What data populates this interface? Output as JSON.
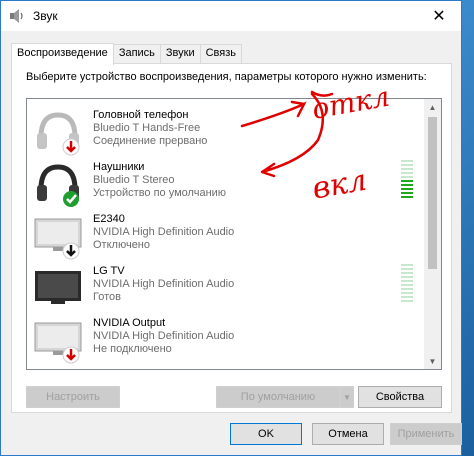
{
  "window": {
    "title": "Звук",
    "close_glyph": "✕"
  },
  "tabs": [
    {
      "label": "Воспроизведение",
      "active": true
    },
    {
      "label": "Запись",
      "active": false
    },
    {
      "label": "Звуки",
      "active": false
    },
    {
      "label": "Связь",
      "active": false
    }
  ],
  "instruction": "Выберите устройство воспроизведения, параметры которого нужно изменить:",
  "devices": [
    {
      "name": "Головной телефон",
      "model": "Bluedio T Hands-Free",
      "status": "Соединение прервано",
      "icon": "headphones-icon",
      "badge": "red-down-arrow",
      "meter": false
    },
    {
      "name": "Наушники",
      "model": "Bluedio T Stereo",
      "status": "Устройство по умолчанию",
      "icon": "headphones-icon",
      "badge": "green-check",
      "meter": true,
      "meter_level": 0.45
    },
    {
      "name": "E2340",
      "model": "NVIDIA High Definition Audio",
      "status": "Отключено",
      "icon": "monitor-icon",
      "badge": "black-down-arrow",
      "meter": false
    },
    {
      "name": "LG TV",
      "model": "NVIDIA High Definition Audio",
      "status": "Готов",
      "icon": "tv-icon",
      "badge": "none",
      "meter": true,
      "meter_level": 0
    },
    {
      "name": "NVIDIA Output",
      "model": "NVIDIA High Definition Audio",
      "status": "Не подключено",
      "icon": "monitor-icon",
      "badge": "red-down-arrow",
      "meter": false
    }
  ],
  "annotations": {
    "top_text": "откл",
    "bottom_text": "вкл",
    "color": "#e00000"
  },
  "buttons": {
    "configure": "Настроить",
    "default": "По умолчанию",
    "properties": "Свойства",
    "ok": "OK",
    "cancel": "Отмена",
    "apply": "Применить"
  },
  "colors": {
    "accent": "#0078d7",
    "meter_active": "#1fa81f",
    "meter_idle": "#c9e7ce"
  }
}
